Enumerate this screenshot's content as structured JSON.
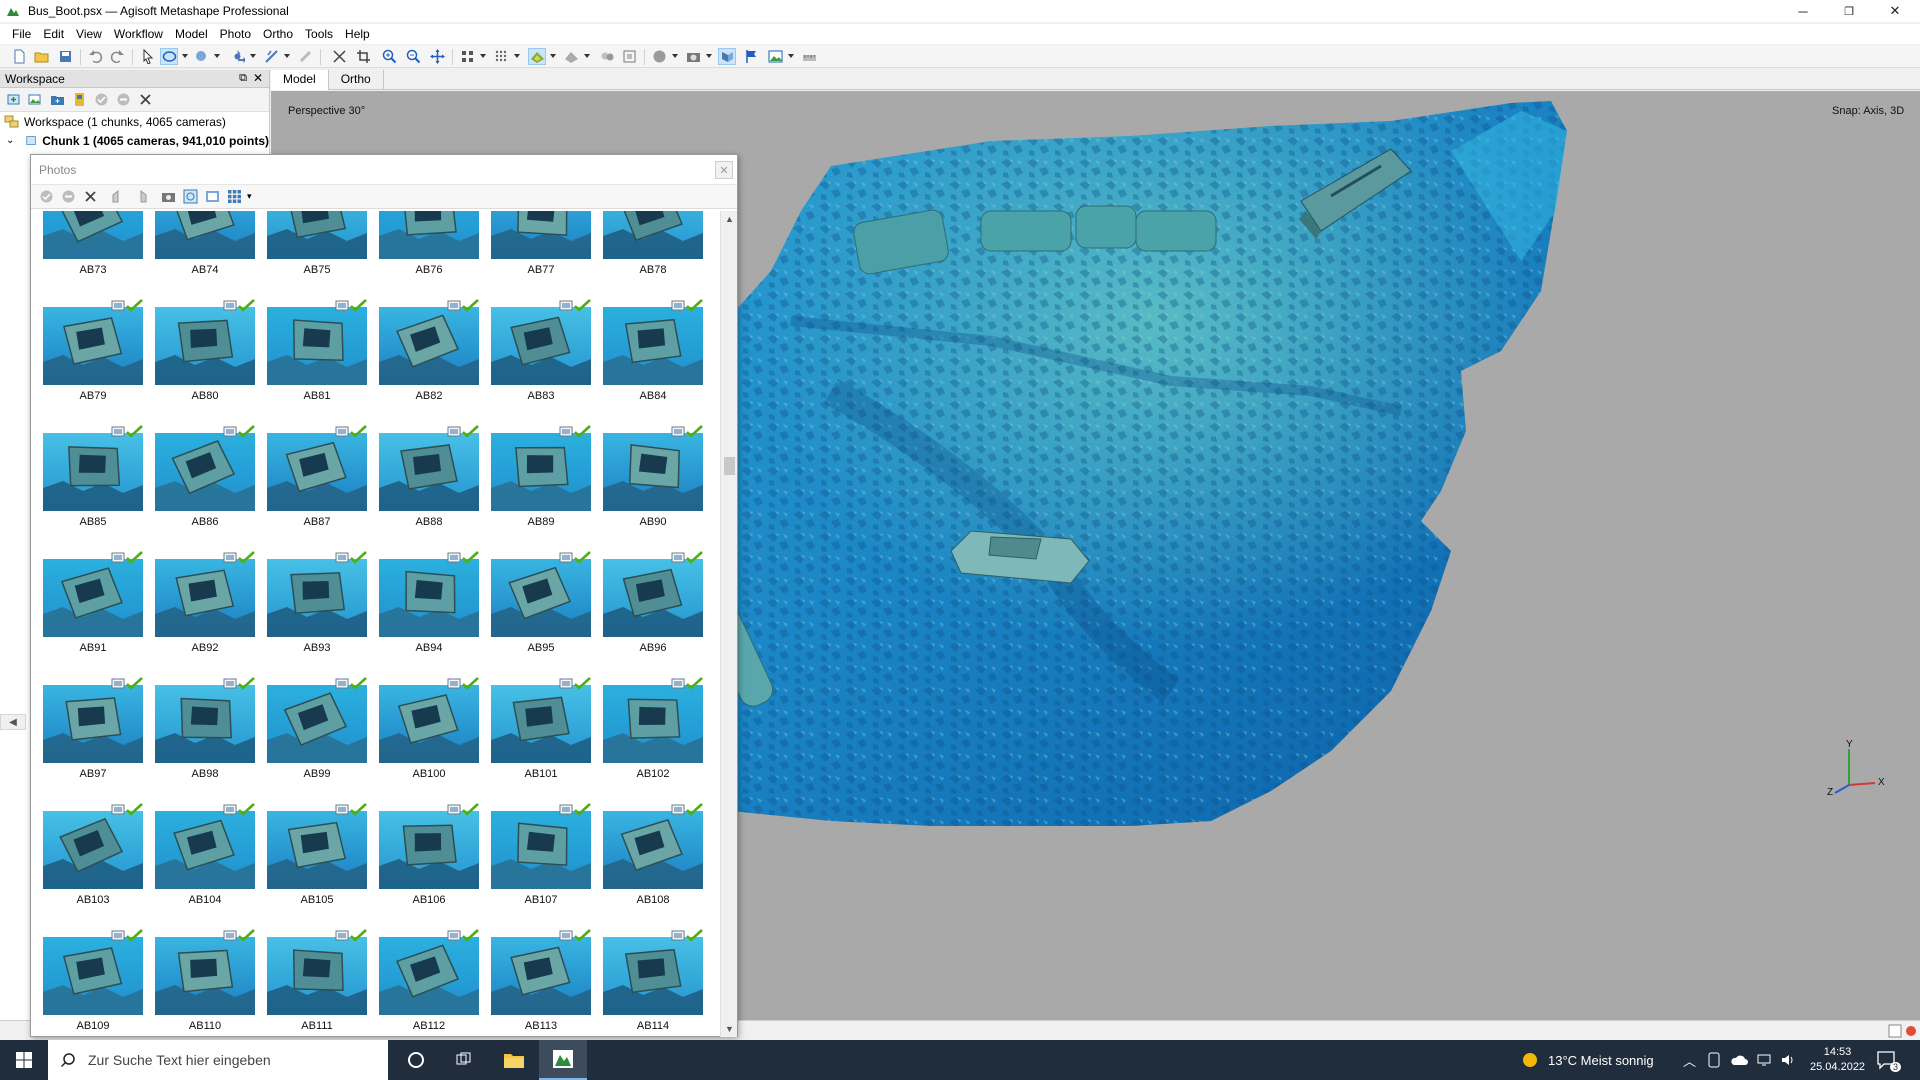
{
  "window": {
    "title": "Bus_Boot.psx — Agisoft Metashape Professional",
    "minimize_glyph": "─",
    "restore_glyph": "❐",
    "close_glyph": "✕"
  },
  "menu": [
    "File",
    "Edit",
    "View",
    "Workflow",
    "Model",
    "Photo",
    "Ortho",
    "Tools",
    "Help"
  ],
  "workspace": {
    "header": "Workspace",
    "tree": {
      "root_label": "Workspace (1 chunks, 4065 cameras)",
      "chunk_label": "Chunk 1 (4065 cameras, 941,010 points)"
    }
  },
  "view_tabs": [
    {
      "label": "Model",
      "active": true
    },
    {
      "label": "Ortho",
      "active": false
    }
  ],
  "viewport": {
    "projection": "Perspective 30°",
    "snap": "Snap: Axis, 3D",
    "axes": {
      "x": "X",
      "y": "Y",
      "z": "Z"
    }
  },
  "photos_panel": {
    "title": "Photos",
    "photos": [
      {
        "label": "AB73"
      },
      {
        "label": "AB74"
      },
      {
        "label": "AB75"
      },
      {
        "label": "AB76"
      },
      {
        "label": "AB77"
      },
      {
        "label": "AB78"
      },
      {
        "label": "AB79"
      },
      {
        "label": "AB80"
      },
      {
        "label": "AB81"
      },
      {
        "label": "AB82"
      },
      {
        "label": "AB83"
      },
      {
        "label": "AB84"
      },
      {
        "label": "AB85"
      },
      {
        "label": "AB86"
      },
      {
        "label": "AB87"
      },
      {
        "label": "AB88"
      },
      {
        "label": "AB89"
      },
      {
        "label": "AB90"
      },
      {
        "label": "AB91"
      },
      {
        "label": "AB92"
      },
      {
        "label": "AB93"
      },
      {
        "label": "AB94"
      },
      {
        "label": "AB95"
      },
      {
        "label": "AB96"
      },
      {
        "label": "AB97"
      },
      {
        "label": "AB98"
      },
      {
        "label": "AB99"
      },
      {
        "label": "AB100"
      },
      {
        "label": "AB101"
      },
      {
        "label": "AB102"
      },
      {
        "label": "AB103"
      },
      {
        "label": "AB104"
      },
      {
        "label": "AB105"
      },
      {
        "label": "AB106"
      },
      {
        "label": "AB107"
      },
      {
        "label": "AB108"
      },
      {
        "label": "AB109"
      },
      {
        "label": "AB110"
      },
      {
        "label": "AB111"
      },
      {
        "label": "AB112"
      },
      {
        "label": "AB113"
      },
      {
        "label": "AB114"
      }
    ]
  },
  "taskbar": {
    "search_placeholder": "Zur Suche Text hier eingeben",
    "weather": "13°C  Meist sonnig",
    "time": "14:53",
    "date": "25.04.2022",
    "notification_count": "3"
  },
  "colors": {
    "accent": "#0078d7",
    "water_deep": "#0a6bb5",
    "water_light": "#3bb8e0",
    "aligned_check": "#4caf1a"
  }
}
